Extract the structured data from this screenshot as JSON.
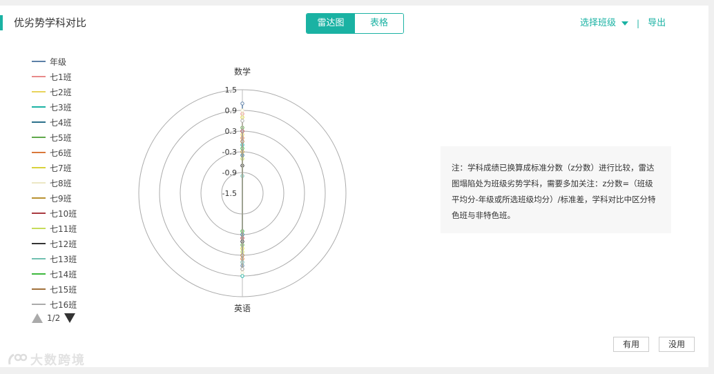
{
  "header": {
    "title": "优劣势学科对比"
  },
  "view_toggle": {
    "radar_label": "雷达图",
    "table_label": "表格"
  },
  "actions": {
    "select_class": "选择班级",
    "export": "导出"
  },
  "legend": {
    "items": [
      {
        "label": "年级",
        "color": "#5b7fa6"
      },
      {
        "label": "七1班",
        "color": "#e88a8a"
      },
      {
        "label": "七2班",
        "color": "#e8d35a"
      },
      {
        "label": "七3班",
        "color": "#1ab2a3"
      },
      {
        "label": "七4班",
        "color": "#2a6f8a"
      },
      {
        "label": "七5班",
        "color": "#5fa84a"
      },
      {
        "label": "七6班",
        "color": "#d9773a"
      },
      {
        "label": "七7班",
        "color": "#d8d23a"
      },
      {
        "label": "七8班",
        "color": "#ece7c4"
      },
      {
        "label": "七9班",
        "color": "#b8902f"
      },
      {
        "label": "七10班",
        "color": "#a8393f"
      },
      {
        "label": "七11班",
        "color": "#c6dc5a"
      },
      {
        "label": "七12班",
        "color": "#333333"
      },
      {
        "label": "七13班",
        "color": "#6fbfb0"
      },
      {
        "label": "七14班",
        "color": "#3cb83c"
      },
      {
        "label": "七15班",
        "color": "#a0703a"
      },
      {
        "label": "七16班",
        "color": "#aaaaaa"
      }
    ],
    "page": "1/2"
  },
  "radar": {
    "axes": [
      "数学",
      "英语"
    ],
    "ticks": [
      "1.5",
      "0.9",
      "0.3",
      "-0.3",
      "-0.9",
      "-1.5"
    ]
  },
  "note": {
    "text": "注：学科成绩已换算成标准分数（z分数）进行比较，雷达图塌陷处为班级劣势学科，需要多加关注：z分数=（班级平均分-年级或所选班级均分）/标准差，学科对比中区分特色班与非特色班。"
  },
  "feedback": {
    "useful": "有用",
    "useless": "没用"
  },
  "watermark": {
    "text": "大数跨境"
  }
}
